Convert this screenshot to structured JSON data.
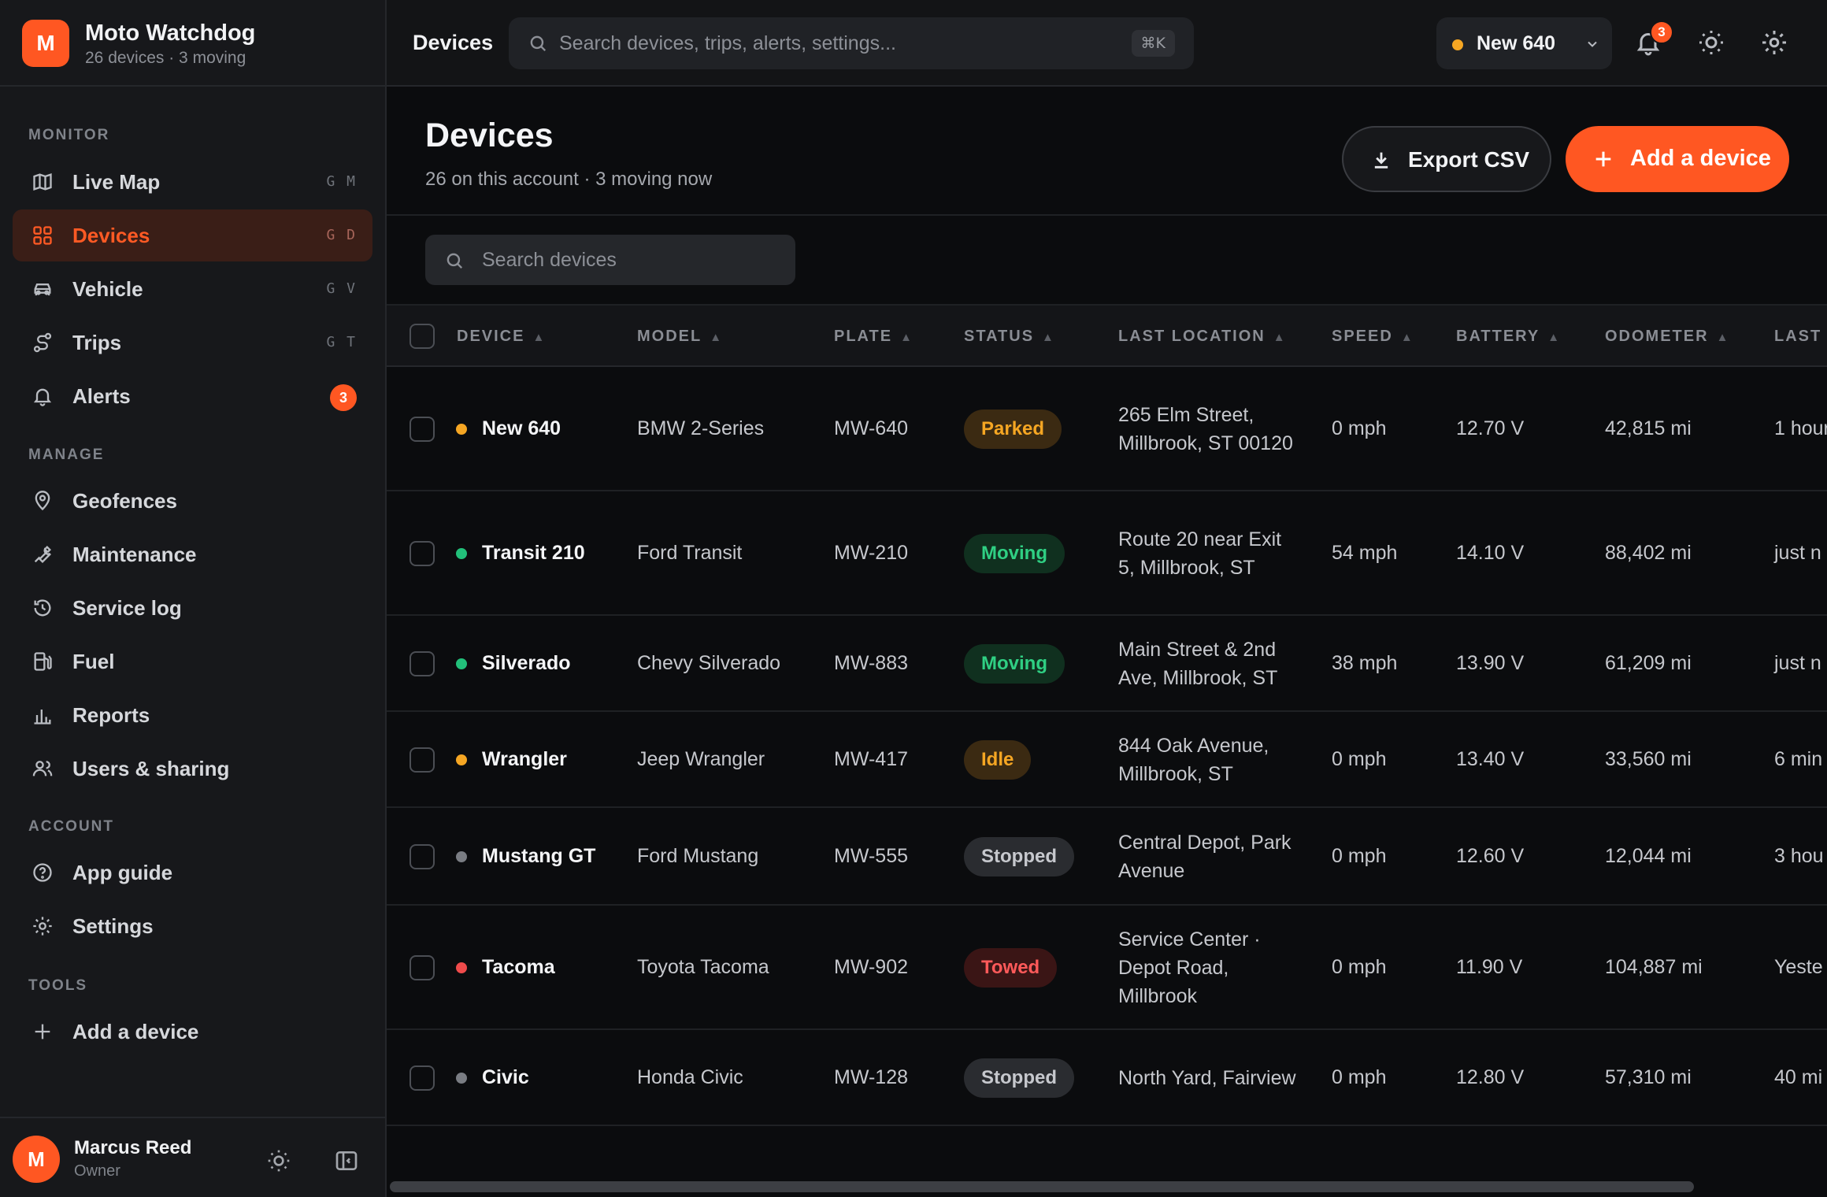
{
  "app": {
    "logo_letter": "M",
    "name": "Moto Watchdog",
    "subtitle": "26 devices · 3 moving"
  },
  "sidebar": {
    "sections": [
      {
        "label": "MONITOR"
      },
      {
        "label": "MANAGE"
      },
      {
        "label": "ACCOUNT"
      },
      {
        "label": "TOOLS"
      }
    ],
    "items": [
      {
        "label": "Live Map",
        "shortcut": "G M",
        "icon": "map-icon"
      },
      {
        "label": "Devices",
        "shortcut": "G D",
        "icon": "grid-icon",
        "active": true
      },
      {
        "label": "Vehicle",
        "shortcut": "G V",
        "icon": "car-icon"
      },
      {
        "label": "Trips",
        "shortcut": "G T",
        "icon": "route-icon"
      },
      {
        "label": "Alerts",
        "badge": "3",
        "icon": "bell-icon"
      },
      {
        "label": "Geofences",
        "icon": "pin-icon"
      },
      {
        "label": "Maintenance",
        "icon": "wrench-icon"
      },
      {
        "label": "Service log",
        "icon": "history-icon"
      },
      {
        "label": "Fuel",
        "icon": "fuel-icon"
      },
      {
        "label": "Reports",
        "icon": "bar-chart-icon"
      },
      {
        "label": "Users & sharing",
        "icon": "users-icon"
      },
      {
        "label": "App guide",
        "icon": "help-icon"
      },
      {
        "label": "Settings",
        "icon": "gear-icon"
      },
      {
        "label": "Add a device",
        "icon": "plus-icon"
      }
    ],
    "user": {
      "initial": "M",
      "name": "Marcus Reed",
      "role": "Owner"
    }
  },
  "topbar": {
    "title": "Devices",
    "search_placeholder": "Search devices, trips, alerts, settings...",
    "search_shortcut": "⌘K",
    "selected_device": "New 640",
    "notification_count": "3"
  },
  "page": {
    "title": "Devices",
    "subtitle": "26 on this account · 3 moving now",
    "export_label": "Export CSV",
    "add_label": "Add a device",
    "table_search_placeholder": "Search devices"
  },
  "table": {
    "columns": [
      "DEVICE",
      "MODEL",
      "PLATE",
      "STATUS",
      "LAST LOCATION",
      "SPEED",
      "BATTERY",
      "ODOMETER",
      "LAST"
    ],
    "rows": [
      {
        "device": "New 640",
        "model": "BMW 2-Series",
        "plate": "MW-640",
        "status": "Parked",
        "location": "265 Elm Street, Millbrook, ST 00120",
        "speed": "0 mph",
        "battery": "12.70 V",
        "odometer": "42,815 mi",
        "last": "1 hour",
        "dot": "#f5a623"
      },
      {
        "device": "Transit 210",
        "model": "Ford Transit",
        "plate": "MW-210",
        "status": "Moving",
        "location": "Route 20 near Exit 5, Millbrook, ST",
        "speed": "54 mph",
        "battery": "14.10 V",
        "odometer": "88,402 mi",
        "last": "just n",
        "dot": "#22c07a"
      },
      {
        "device": "Silverado",
        "model": "Chevy Silverado",
        "plate": "MW-883",
        "status": "Moving",
        "location": "Main Street & 2nd Ave, Millbrook, ST",
        "speed": "38 mph",
        "battery": "13.90 V",
        "odometer": "61,209 mi",
        "last": "just n",
        "dot": "#22c07a"
      },
      {
        "device": "Wrangler",
        "model": "Jeep Wrangler",
        "plate": "MW-417",
        "status": "Idle",
        "location": "844 Oak Avenue, Millbrook, ST",
        "speed": "0 mph",
        "battery": "13.40 V",
        "odometer": "33,560 mi",
        "last": "6 min",
        "dot": "#f5a623"
      },
      {
        "device": "Mustang GT",
        "model": "Ford Mustang",
        "plate": "MW-555",
        "status": "Stopped",
        "location": "Central Depot, Park Avenue",
        "speed": "0 mph",
        "battery": "12.60 V",
        "odometer": "12,044 mi",
        "last": "3 hou",
        "dot": "#7a7d83"
      },
      {
        "device": "Tacoma",
        "model": "Toyota Tacoma",
        "plate": "MW-902",
        "status": "Towed",
        "location": "Service Center · Depot Road, Millbrook",
        "speed": "0 mph",
        "battery": "11.90 V",
        "odometer": "104,887 mi",
        "last": "Yeste",
        "dot": "#ef4b4b"
      },
      {
        "device": "Civic",
        "model": "Honda Civic",
        "plate": "MW-128",
        "status": "Stopped",
        "location": "North Yard, Fairview",
        "speed": "0 mph",
        "battery": "12.80 V",
        "odometer": "57,310 mi",
        "last": "40 mi",
        "dot": "#7a7d83"
      }
    ]
  },
  "colors": {
    "accent": "#ff5722",
    "parked_bg": "#3b2a12",
    "parked_fg": "#f5a623",
    "moving_bg": "#10301f",
    "moving_fg": "#2fcf83",
    "idle_bg": "#3b2a12",
    "idle_fg": "#f5a623",
    "stopped_bg": "#2a2c30",
    "stopped_fg": "#c6c8cd",
    "towed_bg": "#3a1515",
    "towed_fg": "#ff5a5a"
  }
}
